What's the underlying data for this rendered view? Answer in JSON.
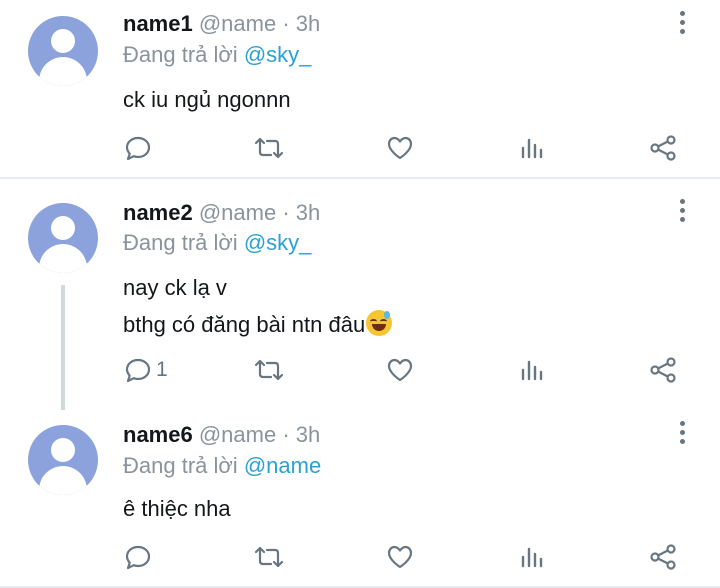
{
  "tweets": [
    {
      "name": "name1",
      "handle": "@name",
      "time": "3h",
      "reply_prefix": "Đang trả lời",
      "reply_to": "@sky_",
      "lines": [
        "ck iu ngủ ngonnn"
      ],
      "reply_count": ""
    },
    {
      "name": "name2",
      "handle": "@name",
      "time": "3h",
      "reply_prefix": "Đang trả lời",
      "reply_to": "@sky_",
      "lines": [
        "nay ck lạ v",
        "bthg có đăng bài ntn đâu"
      ],
      "emoji": "sweat-smile-emoji",
      "reply_count": "1"
    },
    {
      "name": "name6",
      "handle": "@name",
      "time": "3h",
      "reply_prefix": "Đang trả lời",
      "reply_to": "@name",
      "lines": [
        "ê thiệc nha"
      ],
      "reply_count": ""
    }
  ],
  "separator": " · ",
  "icons": [
    "reply-icon",
    "retweet-icon",
    "like-icon",
    "analytics-icon",
    "share-icon",
    "more-icon"
  ],
  "colors": {
    "mention": "#2aa0d4",
    "meta": "#8a939c",
    "icon": "#687682",
    "avatar": "#8ba2dc"
  }
}
